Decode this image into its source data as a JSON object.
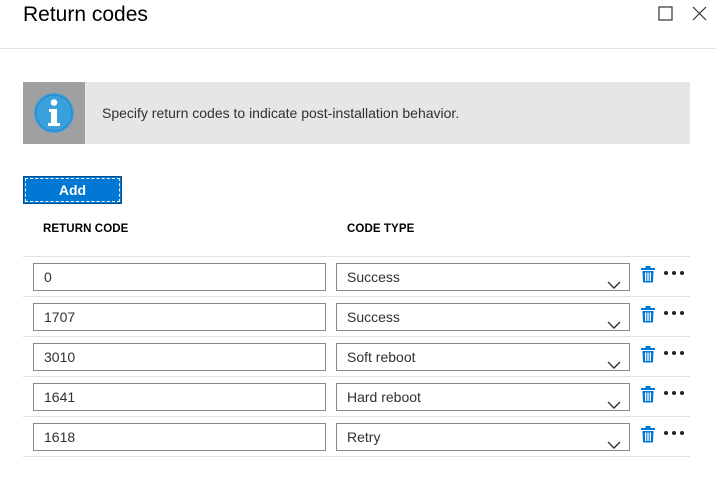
{
  "window": {
    "title": "Return codes",
    "controls": [
      "maximize-icon",
      "close-icon"
    ]
  },
  "info": {
    "icon": "info-icon",
    "text": "Specify return codes to indicate post-installation behavior."
  },
  "toolbar": {
    "add_label": "Add"
  },
  "table": {
    "headers": {
      "code": "RETURN CODE",
      "type": "CODE TYPE"
    },
    "rows": [
      {
        "code": "0",
        "type": "Success"
      },
      {
        "code": "1707",
        "type": "Success"
      },
      {
        "code": "3010",
        "type": "Soft reboot"
      },
      {
        "code": "1641",
        "type": "Hard reboot"
      },
      {
        "code": "1618",
        "type": "Retry"
      }
    ],
    "row_icons": [
      "chevron-down-icon",
      "trash-icon",
      "more-icon"
    ]
  },
  "colors": {
    "accent": "#0078d4",
    "info_bg": "#e6e6e6",
    "info_icon_bg": "#a0a0a0",
    "info_icon": "#3aa0dc",
    "border": "#8a8886"
  }
}
